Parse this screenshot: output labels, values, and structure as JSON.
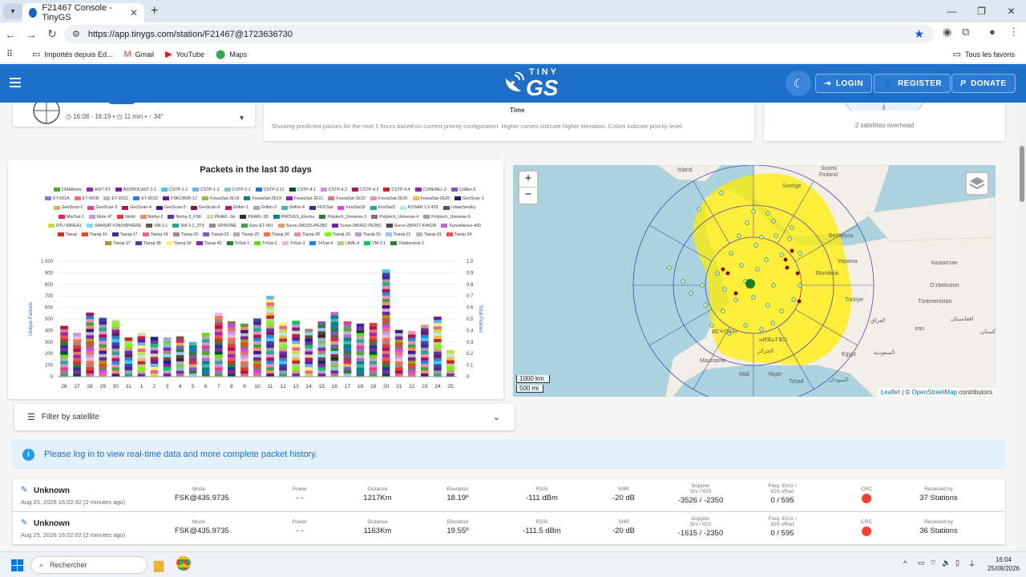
{
  "browser": {
    "tab_title": "F21467 Console - TinyGS",
    "url": "https://app.tinygs.com/station/F21467@1723636730",
    "bookmarks": [
      "Importés depuis Ed...",
      "Gmail",
      "YouTube",
      "Maps"
    ],
    "bookmarks_right": "Tous les favoris"
  },
  "header": {
    "logo_top": "TINY",
    "logo_main": "GS",
    "login": "LOGIN",
    "register": "REGISTER",
    "donate": "DONATE"
  },
  "top_section": {
    "pass_time": "16:08 - 16:19",
    "pass_duration": "11 min",
    "pass_elevation": "34°",
    "time_axis_label": "Time",
    "passes_note": "Showing predicted passes for the next 1 hours based on current priority configuration. Higher curves indicate higher elevation. Colors indicate priority level.",
    "compass_s": "S",
    "satellites_overhead": "2 satellites overhead"
  },
  "packets_chart": {
    "title": "Packets in the last 30 days",
    "y_left_label": "Unique Packets",
    "y_right_label": "Total Frames",
    "legend": [
      [
        "236Alferov",
        "#55a630"
      ],
      [
        "AIST-ST",
        "#9c27b0"
      ],
      [
        "ASTROCAST 0.1",
        "#7b1fa2"
      ],
      [
        "CSTP-1.1",
        "#4fc3f7"
      ],
      [
        "CSTP-1.2",
        "#64b5f6"
      ],
      [
        "CSTP-2.1",
        "#80cbc4"
      ],
      [
        "CSTP-2.11",
        "#1976d2"
      ],
      [
        "CSTP-4.1",
        "#004d40"
      ],
      [
        "CSTP-4.2",
        "#ce93d8"
      ],
      [
        "CSTP-4.3",
        "#ad1457"
      ],
      [
        "CSTP-4.4",
        "#c62828"
      ],
      [
        "CUBEBEL-2",
        "#8e24aa"
      ],
      [
        "Colibri-S",
        "#7e57c2"
      ],
      [
        "ET-001A",
        "#9575cd"
      ],
      [
        "ET-001B",
        "#e57373"
      ],
      [
        "ET-001C",
        "#b0bec5"
      ],
      [
        "ET-001D",
        "#1e88e5"
      ],
      [
        "FSKL5695-12",
        "#6a1b9a"
      ],
      [
        "FossaSat-2E18",
        "#8bc34a"
      ],
      [
        "FossaSat-2E19",
        "#00897b"
      ],
      [
        "FossaSat-2E21",
        "#8e24aa"
      ],
      [
        "FossaSat-2E22",
        "#e57373"
      ],
      [
        "FossaSat-2E25",
        "#f48fb1"
      ],
      [
        "FossaSat-2E26",
        "#ffb74d"
      ],
      [
        "GeoScan-1",
        "#1a237e"
      ],
      [
        "GeoScan-2",
        "#c8b560"
      ],
      [
        "GeoScan-3",
        "#ec407a"
      ],
      [
        "GeoScan-4",
        "#ad1457"
      ],
      [
        "GeoScan-5",
        "#4a148c"
      ],
      [
        "GeoScan-6",
        "#880e4f"
      ],
      [
        "Grifon-1",
        "#c2185b"
      ],
      [
        "Grifon-3",
        "#9fa8da"
      ],
      [
        "Grifon-4",
        "#4db6ac"
      ],
      [
        "HUCSat",
        "#283593"
      ],
      [
        "InnoSat18",
        "#e040fb"
      ],
      [
        "InnoSat3",
        "#26a69a"
      ],
      [
        "KOSAR 1.5 433",
        "#b2ebf2"
      ],
      [
        "Lobachevsky",
        "#6d4c41"
      ],
      [
        "MorSat-1",
        "#e91e63"
      ],
      [
        "Mute 47",
        "#ce93d8"
      ],
      [
        "Norbi",
        "#e53935"
      ],
      [
        "Norby-2",
        "#ff8a65"
      ],
      [
        "Norby-2_FSK",
        "#5e35b1"
      ],
      [
        "PEARL-1A",
        "#c5e1a5"
      ],
      [
        "PEARL-1B",
        "#3e2723"
      ],
      [
        "PROVES_Electra",
        "#00838f"
      ],
      [
        "Polytech_Universe-3",
        "#2e7d32"
      ],
      [
        "Polytech_Universe-4",
        "#8d6e63"
      ],
      [
        "Polytech_Universe-5",
        "#9e9e9e"
      ],
      [
        "RTU MIREA1",
        "#cddc39"
      ],
      [
        "SAMSAT-IONOSPHERE",
        "#80deea"
      ],
      [
        "SM-3.1",
        "#795548"
      ],
      [
        "SM-3.1_2TX",
        "#26a69a"
      ],
      [
        "SPIRONE",
        "#a1887f"
      ],
      [
        "Surv-ET-001",
        "#43a047"
      ],
      [
        "Surve-280325-PE2B2",
        "#d4a373"
      ],
      [
        "Surve-280422-PE2B2",
        "#7b1fa2"
      ],
      [
        "Surve-280427-K4KDR",
        "#5d4037"
      ],
      [
        "Surveillance-400",
        "#ba68c8"
      ],
      [
        "Tianqi",
        "#d32f2f"
      ],
      [
        "Tianqi-16",
        "#e64a19"
      ],
      [
        "Tianqi-17",
        "#4527a0"
      ],
      [
        "Tianqi-18",
        "#f06292"
      ],
      [
        "Tianqi-20",
        "#a1887f"
      ],
      [
        "Tianqi-23",
        "#7e57c2"
      ],
      [
        "Tianqi-25",
        "#bcaaa4"
      ],
      [
        "Tianqi-26",
        "#ff7043"
      ],
      [
        "Tianqi-28",
        "#f48fb1"
      ],
      [
        "Tianqi-29",
        "#76ff03"
      ],
      [
        "Tianqi-30",
        "#b39ddb"
      ],
      [
        "Tianqi-31",
        "#90caf9"
      ],
      [
        "Tianqi-33",
        "#b0bec5"
      ],
      [
        "Tianqi-34",
        "#ef5350"
      ],
      [
        "Tianqi-37",
        "#9e9d24"
      ],
      [
        "Tianqi-38",
        "#3949ab"
      ],
      [
        "Tianqi-39",
        "#fff176"
      ],
      [
        "Tianqi-40",
        "#8e24aa"
      ],
      [
        "TriSat-1",
        "#2e7d32"
      ],
      [
        "TriSat-2",
        "#64dd17"
      ],
      [
        "TriSat-3",
        "#e1bee7"
      ],
      [
        "TriSat-4",
        "#1e88e5"
      ],
      [
        "UWE-4",
        "#aed581"
      ],
      [
        "VM-3.1",
        "#00c853"
      ],
      [
        "Vladivostok-2",
        "#2e7d32"
      ]
    ],
    "y_left_ticks": [
      "0",
      "100",
      "200",
      "300",
      "400",
      "500",
      "600",
      "700",
      "800",
      "900",
      "1 000"
    ],
    "y_right_ticks": [
      "0",
      "0.1",
      "0.2",
      "0.3",
      "0.4",
      "0.5",
      "0.6",
      "0.7",
      "0.8",
      "0.9",
      "1.0"
    ]
  },
  "chart_data": {
    "type": "bar",
    "title": "Packets in the last 30 days",
    "ylabel": "Unique Packets",
    "y2label": "Total Frames",
    "ylim": [
      0,
      1000
    ],
    "y2lim": [
      0,
      1
    ],
    "categories": [
      "26",
      "27",
      "28",
      "29",
      "30",
      "31",
      "1",
      "2",
      "3",
      "4",
      "5",
      "6",
      "7",
      "8",
      "9",
      "10",
      "11",
      "12",
      "13",
      "14",
      "15",
      "16",
      "17",
      "18",
      "19",
      "20",
      "21",
      "22",
      "23",
      "24",
      "25"
    ],
    "values": [
      440,
      380,
      555,
      510,
      490,
      340,
      380,
      345,
      340,
      350,
      300,
      380,
      555,
      480,
      460,
      505,
      700,
      470,
      485,
      415,
      480,
      560,
      480,
      460,
      465,
      930,
      405,
      395,
      450,
      520,
      230
    ]
  },
  "map": {
    "zoom_in": "+",
    "zoom_out": "−",
    "scale_km": "1000 km",
    "scale_mi": "500 mi",
    "attribution_prefix": "Leaflet",
    "attribution_mid": " | © ",
    "attribution_osm": "OpenStreetMap",
    "attribution_suffix": " contributors",
    "places": [
      [
        "Ísland",
        205,
        8
      ],
      [
        "Sverige",
        336,
        28
      ],
      [
        "Suomi",
        384,
        6
      ],
      [
        "Finland",
        382,
        14
      ],
      [
        "Беларусь",
        394,
        90
      ],
      [
        "Україна",
        405,
        122
      ],
      [
        "Казахстан",
        522,
        124
      ],
      [
        "România",
        378,
        137
      ],
      [
        "Türkiye",
        414,
        170
      ],
      [
        "Oʻzbekiston",
        520,
        152
      ],
      [
        "Türkmenistan",
        505,
        172
      ],
      [
        "العراق",
        446,
        196
      ],
      [
        "افغانستان",
        546,
        194
      ],
      [
        "Iran",
        501,
        206
      ],
      [
        "پاکستان",
        583,
        210
      ],
      [
        "السعودية",
        450,
        236
      ],
      [
        "Egypt",
        410,
        238
      ],
      [
        "Mauritanie",
        233,
        246
      ],
      [
        "Mali",
        282,
        263
      ],
      [
        "Niger",
        319,
        263
      ],
      [
        "Tchad",
        344,
        272
      ],
      [
        "السودان",
        394,
        270
      ],
      [
        "ⴰⵍⵣⴰⵢⴻⵔ",
        307,
        220
      ],
      [
        "الجزائر",
        305,
        234
      ],
      [
        "ⵍⵎⵖⵔⵉⴱ",
        248,
        210
      ]
    ]
  },
  "filter": {
    "label": "Filter by satellite"
  },
  "notice": "Please log in to view real-time data and more complete packet history.",
  "packet_labels": {
    "mode": "Mode",
    "power": "Power",
    "distance": "Distance",
    "elevation": "Elevation",
    "rssi": "RSSI",
    "snr": "SNR",
    "doppler": "Doppler",
    "doppler_sub": "Srv / tGS",
    "freq": "Freq. Error /",
    "freq_sub": "tGS offset",
    "crc": "CRC",
    "received": "Received by"
  },
  "packets": [
    {
      "name": "Unknown",
      "time": "Aug 25, 2026 16:02:32 (2 minutes ago)",
      "mode": "FSK@435.9735",
      "power": "- -",
      "distance": "1217Km",
      "elevation": "18.19º",
      "rssi": "-111 dBm",
      "snr": "-20 dB",
      "doppler": "-3526 / -2350",
      "freq": "0 / 595",
      "received": "37 Stations"
    },
    {
      "name": "Unknown",
      "time": "Aug 25, 2026 16:02:02 (2 minutes ago)",
      "mode": "FSK@435.9735",
      "power": "- -",
      "distance": "1163Km",
      "elevation": "19.55º",
      "rssi": "-111.5 dBm",
      "snr": "-20 dB",
      "doppler": "-1615 / -2350",
      "freq": "0 / 595",
      "received": "36 Stations"
    }
  ],
  "taskbar": {
    "search": "Rechercher",
    "time": "16:04",
    "date": "25/08/2026"
  }
}
